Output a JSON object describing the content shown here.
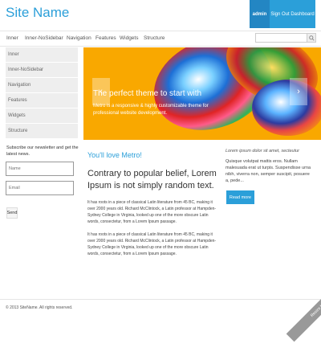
{
  "site": {
    "title": "Site Name"
  },
  "topbar": {
    "admin_label": "admin",
    "signout_label": "Sign Out Dashboard"
  },
  "nav": {
    "items": [
      "Inner",
      "Inner-NoSidebar",
      "Navigation",
      "Features",
      "Widgets",
      "Structure"
    ]
  },
  "search": {
    "placeholder": ""
  },
  "sidebar": {
    "items": [
      "Inner",
      "Inner-NoSidebar",
      "Navigation",
      "Features",
      "Widgets",
      "Structure"
    ]
  },
  "hero": {
    "title": "The perfect theme to start with",
    "text": "Metro is a responsive & highly customizable theme for professional website development.",
    "prev_glyph": "‹",
    "next_glyph": "›"
  },
  "newsletter": {
    "label": "Subscribe our newsletter and get the latest news.",
    "name_placeholder": "Name",
    "email_placeholder": "Email",
    "send_label": "Send"
  },
  "main": {
    "love": "You'll love Metro!",
    "lead": "Contrary to popular belief, Lorem Ipsum is not simply random text.",
    "para1": "It has roots in a piece of classical Latin literature from 45 BC, making it over 2000 years old. Richard McClintock, a Latin professor at Hampden-Sydney College in Virginia, looked up one of the more obscure Latin words, consectetur, from a Lorem Ipsum passage.",
    "para2": "It has roots in a piece of classical Latin literature from 45 BC, making it over 2000 years old. Richard McClintock, a Latin professor at Hampden-Sydney College in Virginia, looked up one of the more obscure Latin words, consectetur, from a Lorem Ipsum passage."
  },
  "aside": {
    "heading": "Lorem ipsum dolor sit amet, secteutur",
    "text": "Quisque volutpat mattis eros. Nullam malesuada erat ut turpis. Suspendisse urna nibh, viverra non, semper suscipit, posuere a, pede...",
    "read_more": "Read more"
  },
  "footer": {
    "text": "© 2013 SiteName. All rights reserved."
  },
  "ribbon": {
    "label": "Resize Me!"
  },
  "colors": {
    "accent": "#2b9fd9",
    "accent_dark": "#2386c3",
    "hero_bg": "#f9a800"
  }
}
